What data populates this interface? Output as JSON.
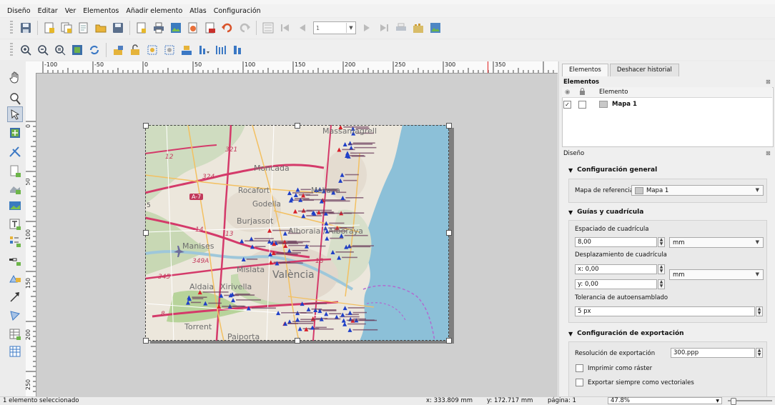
{
  "menu": [
    "Diseño",
    "Editar",
    "Ver",
    "Elementos",
    "Añadir elemento",
    "Atlas",
    "Configuración"
  ],
  "toolbar1": {
    "icons": [
      "save-icon",
      "new-layout-icon",
      "duplicate-layout-icon",
      "layout-manager-icon",
      "open-template-icon",
      "save-template-icon",
      "page-setup-icon",
      "print-icon",
      "export-image-icon",
      "export-svg-icon",
      "export-pdf-icon",
      "undo-icon",
      "redo-icon"
    ],
    "atlas_icons": [
      "atlas-preview-icon",
      "atlas-first-icon",
      "atlas-prev-icon",
      "atlas-next-icon",
      "atlas-last-icon",
      "atlas-print-icon",
      "atlas-export-icon",
      "atlas-settings-icon"
    ],
    "atlas_page": "1"
  },
  "toolbar2": {
    "icons": [
      "zoom-full-icon",
      "zoom-in-icon",
      "zoom-out-icon",
      "zoom-actual-icon",
      "refresh-icon",
      "lock-icon",
      "unlock-icon",
      "group-icon",
      "ungroup-icon",
      "raise-icon",
      "lower-icon",
      "align-icon",
      "distribute-icon"
    ]
  },
  "tools": [
    "pan-tool-icon",
    "zoom-tool-icon",
    "select-tool-icon",
    "move-content-icon",
    "edit-nodes-icon",
    "add-page-icon",
    "add-map-icon",
    "add-image-icon",
    "add-text-icon",
    "add-legend-icon",
    "add-scalebar-icon",
    "add-shape-icon",
    "add-arrow-icon",
    "add-node-item-icon",
    "add-table-icon",
    "add-html-icon"
  ],
  "ruler": {
    "h_labels": [
      "-100",
      "-50",
      "0",
      "50",
      "100",
      "150",
      "200",
      "250",
      "300",
      "350"
    ],
    "v_labels": [
      "0",
      "50",
      "100",
      "150",
      "200",
      "250"
    ]
  },
  "map": {
    "places": {
      "massamagrell": "Massamagrell",
      "moncada": "Moncada",
      "rocafort": "Rocafort",
      "godella": "Godella",
      "meliana": "Meliana",
      "burjassot": "Burjassot",
      "alboraia": "Alboraia / Alboraya",
      "manises": "Manises",
      "mislata": "Mislata",
      "valencia": "València",
      "aldaia": "Aldaia",
      "xirivella": "Xirivella",
      "torrent": "Torrent",
      "paiporta": "Paiporta"
    },
    "roads": [
      "A-7",
      "324",
      "321",
      "345",
      "349A",
      "12",
      "14",
      "18",
      "8",
      "13",
      "5"
    ]
  },
  "panel": {
    "tabs": [
      "Elementos",
      "Deshacer historial"
    ],
    "elements_title": "Elementos",
    "elements_column": "Elemento",
    "element_item": "Mapa 1",
    "element_visible": "✓",
    "design_title": "Diseño",
    "close": "⊠",
    "general": {
      "title": "Configuración general",
      "ref_map_label": "Mapa de referencia",
      "ref_map_value": "Mapa 1"
    },
    "grid": {
      "title": "Guías y cuadrícula",
      "spacing_label": "Espaciado de cuadrícula",
      "spacing_value": "8,00",
      "spacing_unit": "mm",
      "offset_label": "Desplazamiento de cuadrícula",
      "offset_x": "x: 0,00",
      "offset_y": "y: 0,00",
      "offset_unit": "mm",
      "snap_label": "Tolerancia de autoensamblado",
      "snap_value": "5 px"
    },
    "export": {
      "title": "Configuración de exportación",
      "resolution_label": "Resolución de exportación",
      "resolution_value": "300.ppp",
      "raster_label": "Imprimir como ráster",
      "vector_label": "Exportar siempre como vectoriales"
    }
  },
  "status": {
    "selection": "1 elemento seleccionado",
    "x": "x: 333.809 mm",
    "y": "y: 172.717 mm",
    "page": "página: 1",
    "zoom": "47.8%"
  },
  "colors": {
    "sea": "#8cc0d8",
    "land": "#ece7dc",
    "green": "#b7d39a",
    "highway": "#d43a6a",
    "road": "#f3c061",
    "marker_blue": "#1f3fc7",
    "marker_red": "#d8202a"
  }
}
